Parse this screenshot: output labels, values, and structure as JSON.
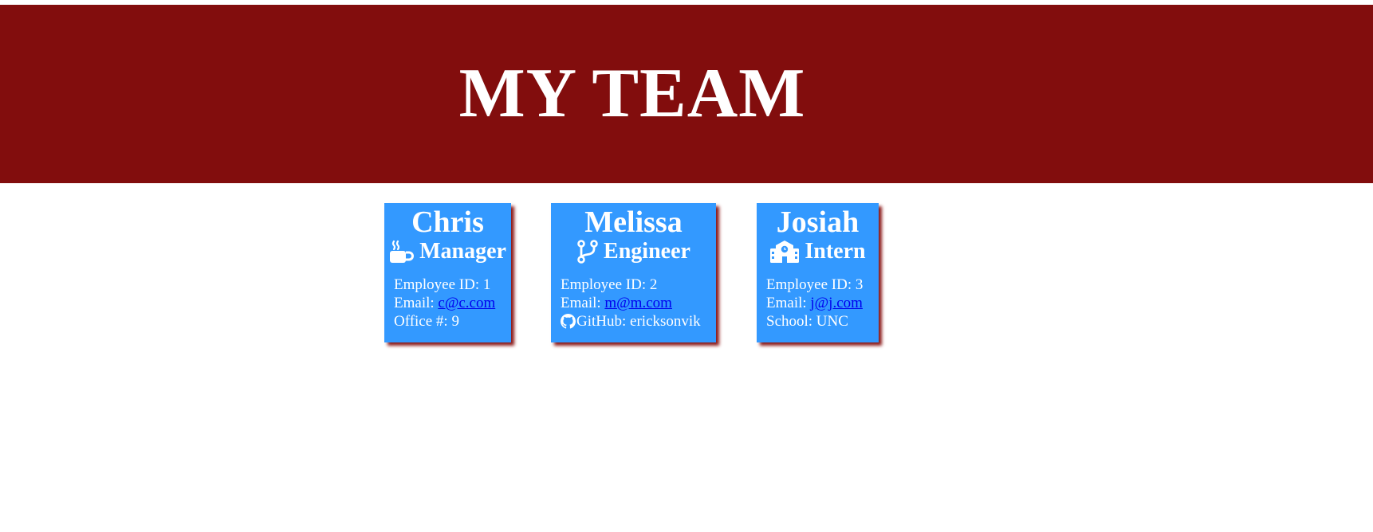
{
  "header": {
    "title": "MY TEAM"
  },
  "colors": {
    "header_bg": "#820d0d",
    "card_bg": "#3399ff",
    "card_shadow": "#8b1a1a",
    "link": "#0000ee"
  },
  "employees": [
    {
      "name": "Chris",
      "role": "Manager",
      "role_icon": "coffee-cup-icon",
      "id_label": "Employee ID: 1",
      "email_prefix": "Email: ",
      "email": "c@c.com",
      "extra": "Office #: 9"
    },
    {
      "name": "Melissa",
      "role": "Engineer",
      "role_icon": "code-branch-icon",
      "id_label": "Employee ID: 2",
      "email_prefix": "Email: ",
      "email": "m@m.com",
      "extra_icon": "github-icon",
      "extra": "GitHub: ericksonvik"
    },
    {
      "name": "Josiah",
      "role": "Intern",
      "role_icon": "school-icon",
      "id_label": "Employee ID: 3",
      "email_prefix": "Email: ",
      "email": "j@j.com",
      "extra": "School: UNC"
    }
  ]
}
